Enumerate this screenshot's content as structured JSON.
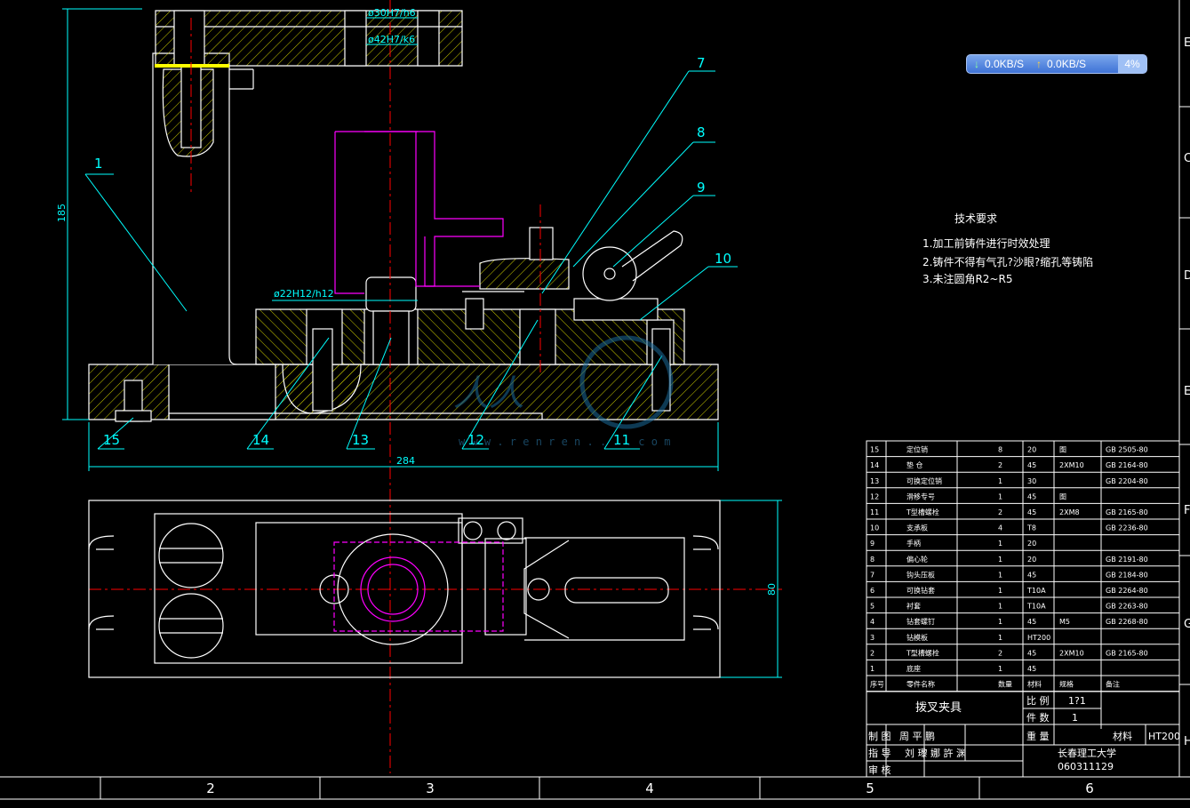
{
  "colors": {
    "background": "#000000",
    "cyan": "#00ffff",
    "white": "#ffffff",
    "yellow": "#ffff00",
    "magenta": "#ff00ff",
    "red": "#ff0000",
    "green": "#00ff00"
  },
  "dimensions": {
    "height": "185",
    "width": "284",
    "plan_height": "80",
    "fit_30": "ø30H7/h6",
    "fit_42": "ø42H7/k6",
    "fit_22": "ø22H12/h12"
  },
  "balloons": [
    "1",
    "7",
    "8",
    "9",
    "10",
    "11",
    "12",
    "13",
    "14",
    "15"
  ],
  "tech_requirements": {
    "title": "技术要求",
    "items": [
      "1.加工前铸件进行时效处理",
      "2.铸件不得有气孔?沙眼?缩孔等铸陷",
      "3.未注圆角R2~R5"
    ]
  },
  "watermark": {
    "logo": "人人",
    "url": "w w w . r e n r e n . . . . c o m"
  },
  "bom": {
    "rows": [
      [
        "15",
        "定位销",
        "8",
        "20",
        "图",
        "GB 2505-80"
      ],
      [
        "14",
        "垫 仓",
        "2",
        "45",
        "2XM10",
        "GB 2164-80"
      ],
      [
        "13",
        "可换定位销",
        "1",
        "30",
        "",
        "GB 2204-80"
      ],
      [
        "12",
        "滑移专号",
        "1",
        "45",
        "图",
        "",
        ""
      ],
      [
        "11",
        "T型槽螺栓",
        "2",
        "45",
        "2XM8",
        "GB 2165-80"
      ],
      [
        "10",
        "支承板",
        "4",
        "T8",
        "",
        "GB 2236-80"
      ],
      [
        "9",
        "手柄",
        "1",
        "20",
        "",
        ""
      ],
      [
        "8",
        "偏心轮",
        "1",
        "20",
        "",
        "GB 2191-80"
      ],
      [
        "7",
        "钩头压板",
        "1",
        "45",
        "",
        "GB 2184-80"
      ],
      [
        "6",
        "可换钻套",
        "1",
        "T10A",
        "",
        "GB 2264-80"
      ],
      [
        "5",
        "衬套",
        "1",
        "T10A",
        "",
        "GB 2263-80"
      ],
      [
        "4",
        "钻套螺钉",
        "1",
        "45",
        "M5",
        "GB 2268-80"
      ],
      [
        "3",
        "钻模板",
        "1",
        "HT200",
        "",
        ""
      ],
      [
        "2",
        "T型槽螺栓",
        "2",
        "45",
        "2XM10",
        "GB 2165-80"
      ],
      [
        "1",
        "底座",
        "1",
        "45",
        "",
        ""
      ]
    ],
    "header": [
      "序号",
      "零件名称",
      "数量",
      "材料",
      "规格",
      "备注"
    ]
  },
  "title_block": {
    "part_name": "拨叉夹具",
    "scale_label": "比 例",
    "scale": "1?1",
    "qty_label": "件 数",
    "qty": "1",
    "weight_label": "重 量",
    "material_label": "材料",
    "material": "HT200",
    "drawn_label": "制 图",
    "drawn_by": "周 平 鹏",
    "guide_label": "指 导",
    "guide_by": "刘 瓈 娜 許 渊",
    "check_label": "审 核",
    "school": "长春理工大学",
    "code": "060311129"
  },
  "zones_bottom": [
    "2",
    "3",
    "4",
    "5",
    "6"
  ],
  "zones_right": [
    "E",
    "C",
    "D",
    "E",
    "F",
    "G",
    "H"
  ],
  "network_widget": {
    "down": "0.0KB/S",
    "up": "0.0KB/S",
    "cpu": "4%"
  }
}
